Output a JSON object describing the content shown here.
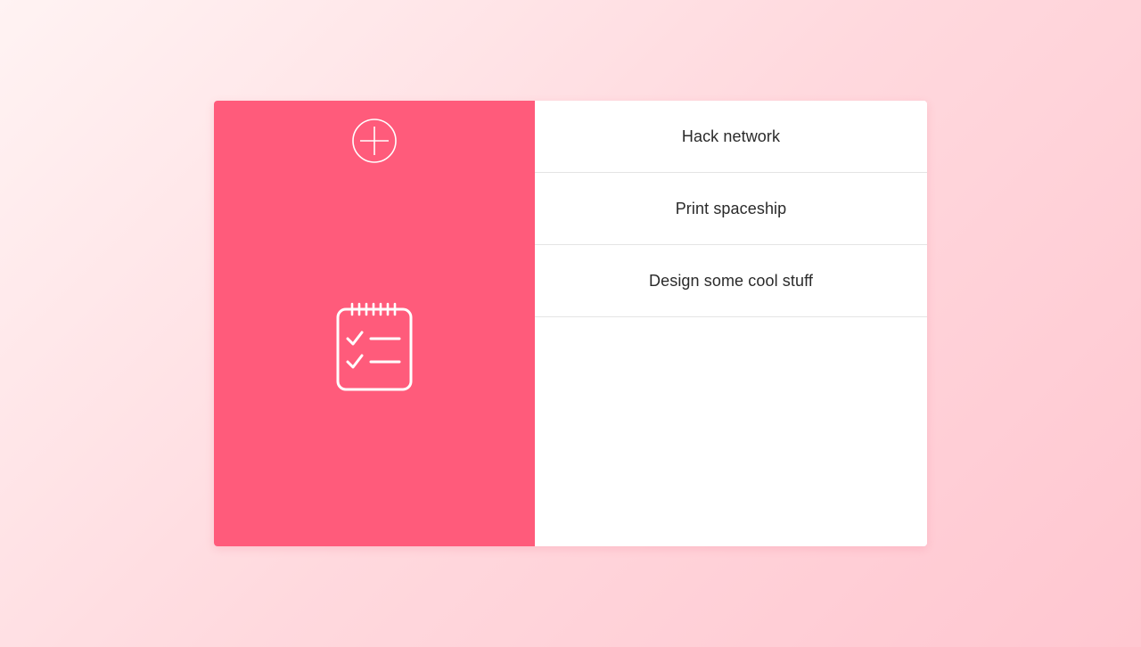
{
  "app": {
    "add_button_icon": "plus-circle-icon",
    "hero_icon": "notepad-checklist-icon"
  },
  "colors": {
    "accent": "#ff5b7b",
    "panel": "#ffffff",
    "divider": "#e4e4e4",
    "text": "#2a2a2a",
    "background_start": "#fff3f3",
    "background_end": "#ffc6d0"
  },
  "tasks": [
    {
      "label": "Hack network"
    },
    {
      "label": "Print spaceship"
    },
    {
      "label": "Design some cool stuff"
    }
  ]
}
